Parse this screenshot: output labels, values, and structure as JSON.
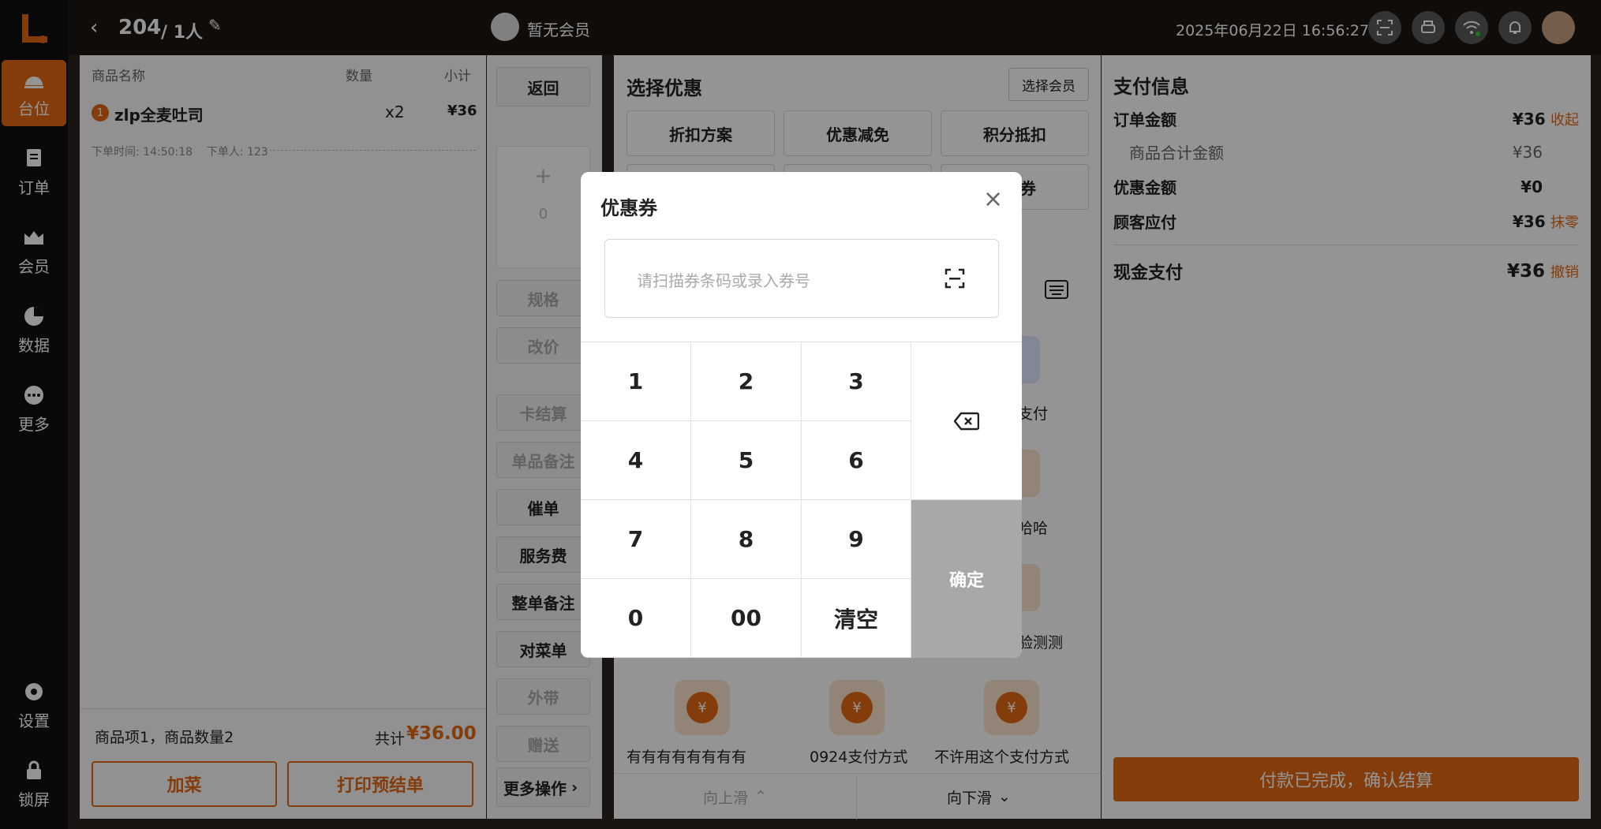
{
  "nav": {
    "items": [
      {
        "label": "台位",
        "icon": "table-icon"
      },
      {
        "label": "订单",
        "icon": "order-icon"
      },
      {
        "label": "会员",
        "icon": "member-icon"
      },
      {
        "label": "数据",
        "icon": "pie-chart-icon"
      },
      {
        "label": "更多",
        "icon": "more-icon"
      }
    ],
    "settings": "设置",
    "lock": "锁屏"
  },
  "topbar": {
    "table_no": "204",
    "guests": "/ 1人",
    "member": "暂无会员",
    "datetime": "2025年06月22日 16:56:27"
  },
  "order_list": {
    "headers": {
      "name": "商品名称",
      "qty": "数量",
      "subtotal": "小计"
    },
    "items": [
      {
        "index": "1",
        "name": "zlp全麦吐司",
        "qty": "x2",
        "price": "¥36"
      }
    ],
    "meta": "下单时间: 14:50:18    下单人: 123",
    "summary": "商品项1，商品数量2",
    "total_label": "共计",
    "total": "¥36.00",
    "add_button": "加菜",
    "print_button": "打印预结单"
  },
  "actions": {
    "back": "返回",
    "stepper_plus": "+",
    "stepper_value": "0",
    "spec": "规格",
    "change_price": "改价",
    "card_settle": "卡结算",
    "item_note": "单品备注",
    "urge": "催单",
    "service_fee": "服务费",
    "order_note": "整单备注",
    "check_menu": "对菜单",
    "takeaway": "外带",
    "gift": "赠送",
    "more": "更多操作"
  },
  "discount": {
    "title": "选择优惠",
    "select_member": "选择会员",
    "options": [
      "折扣方案",
      "优惠减免",
      "积分抵扣"
    ],
    "option_row2_partial": "券",
    "pay_method_fragments": [
      "支付",
      "哈哈",
      "验测测"
    ],
    "pay_methods": [
      "有有有有有有有有",
      "0924支付方式",
      "不许用这个支付方式"
    ],
    "scroll_up": "向上滑",
    "scroll_down": "向下滑"
  },
  "payment": {
    "title": "支付信息",
    "order_amount_label": "订单金额",
    "order_amount": "¥36",
    "collapse": "收起",
    "goods_total_label": "商品合计金额",
    "goods_total": "¥36",
    "discount_label": "优惠金额",
    "discount": "¥0",
    "due_label": "顾客应付",
    "due": "¥36",
    "round_off": "抹零",
    "cash_label": "现金支付",
    "cash": "¥36",
    "revoke": "撤销",
    "confirm": "付款已完成，确认结算"
  },
  "coupon_dialog": {
    "title": "优惠券",
    "placeholder": "请扫描券条码或录入券号",
    "keys": [
      "1",
      "2",
      "3",
      "4",
      "5",
      "6",
      "7",
      "8",
      "9",
      "0",
      "00",
      "清空"
    ],
    "confirm": "确定"
  },
  "colors": {
    "accent": "#e36a12",
    "confirm_key": "#a8a8a8"
  }
}
